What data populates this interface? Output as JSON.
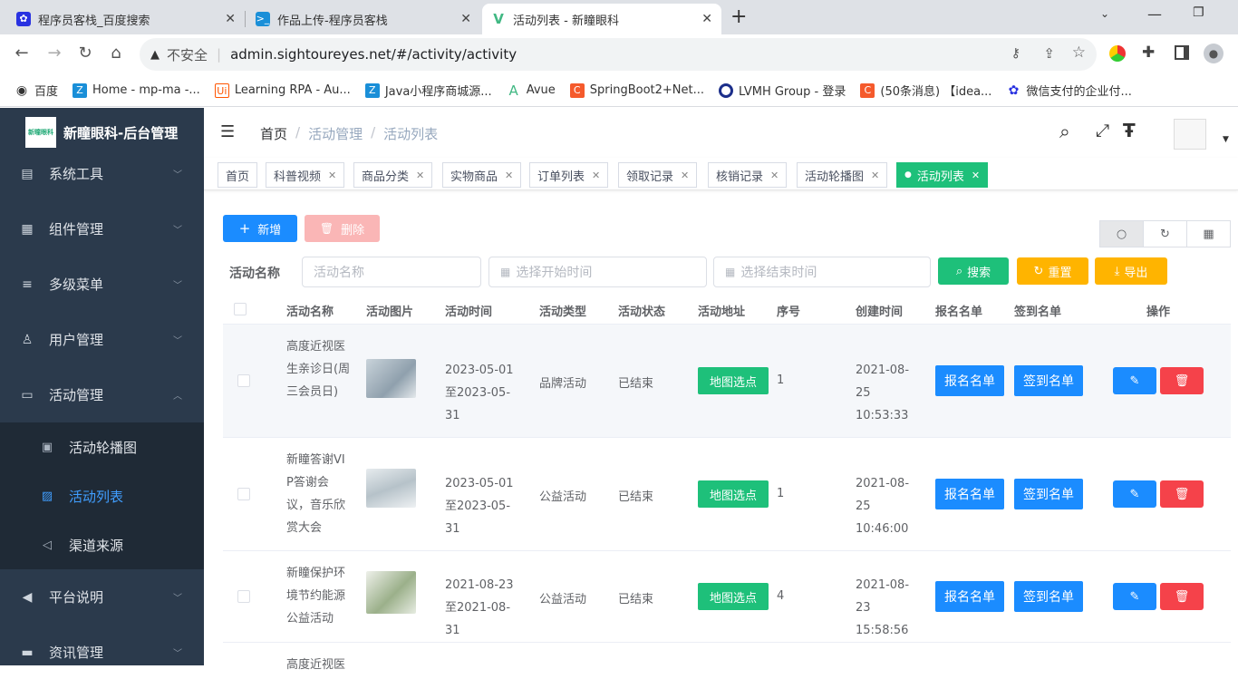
{
  "browser": {
    "tabs": [
      {
        "title": "程序员客栈_百度搜索",
        "fav": "paw-icon"
      },
      {
        "title": "作品上传-程序员客栈",
        "fav": "terminal-icon"
      },
      {
        "title": "活动列表 - 新瞳眼科",
        "fav": "vue-icon"
      }
    ],
    "new_tab": "+",
    "security": "不安全",
    "url": "admin.sightoureyes.net/#/activity/activity",
    "bookmarks": [
      {
        "label": "百度"
      },
      {
        "label": "Home - mp-ma -..."
      },
      {
        "label": "Learning RPA - Au..."
      },
      {
        "label": "Java小程序商城源..."
      },
      {
        "label": "Avue"
      },
      {
        "label": "SpringBoot2+Net..."
      },
      {
        "label": "LVMH Group - 登录"
      },
      {
        "label": "(50条消息) 【idea..."
      },
      {
        "label": "微信支付的企业付..."
      }
    ]
  },
  "sidebar": {
    "logo_text": "新瞳眼科-后台管理",
    "logo_mark": "新瞳眼科",
    "items": [
      {
        "label": "系统工具",
        "icon": "briefcase-icon"
      },
      {
        "label": "组件管理",
        "icon": "grid-icon"
      },
      {
        "label": "多级菜单",
        "icon": "list-icon"
      },
      {
        "label": "用户管理",
        "icon": "user-icon"
      },
      {
        "label": "活动管理",
        "icon": "monitor-icon"
      }
    ],
    "sub_items": [
      {
        "label": "活动轮播图",
        "icon": "image-icon"
      },
      {
        "label": "活动列表",
        "icon": "gallery-icon"
      },
      {
        "label": "渠道来源",
        "icon": "send-icon"
      }
    ],
    "items_after": [
      {
        "label": "平台说明",
        "icon": "speaker-icon"
      },
      {
        "label": "资讯管理",
        "icon": "chat-icon"
      }
    ]
  },
  "breadcrumb": {
    "home": "首页",
    "sep": "/",
    "level1": "活动管理",
    "level2": "活动列表"
  },
  "tags": [
    "首页",
    "科普视频",
    "商品分类",
    "实物商品",
    "订单列表",
    "领取记录",
    "核销记录",
    "活动轮播图",
    "活动列表"
  ],
  "toolbar": {
    "add": "新增",
    "delete": "删除"
  },
  "search": {
    "label": "活动名称",
    "name_placeholder": "活动名称",
    "start_placeholder": "选择开始时间",
    "end_placeholder": "选择结束时间",
    "search_btn": "搜索",
    "reset_btn": "重置",
    "export_btn": "导出"
  },
  "table": {
    "headers": [
      "活动名称",
      "活动图片",
      "活动时间",
      "活动类型",
      "活动状态",
      "活动地址",
      "序号",
      "创建时间",
      "报名名单",
      "签到名单",
      "操作"
    ],
    "rows": [
      {
        "name": "高度近视医生亲诊日(周三会员日)",
        "time": "2023-05-01至2023-05-31",
        "type": "品牌活动",
        "status": "已结束",
        "addr_btn": "地图选点",
        "seq": "1",
        "created": "2021-08-25 10:53:33",
        "signup": "报名名单",
        "checkin": "签到名单"
      },
      {
        "name": "新瞳答谢VIP答谢会议，音乐欣赏大会",
        "time": "2023-05-01至2023-05-31",
        "type": "公益活动",
        "status": "已结束",
        "addr_btn": "地图选点",
        "seq": "1",
        "created": "2021-08-25 10:46:00",
        "signup": "报名名单",
        "checkin": "签到名单"
      },
      {
        "name": "新瞳保护环境节约能源公益活动",
        "time": "2021-08-23至2021-08-31",
        "type": "公益活动",
        "status": "已结束",
        "addr_btn": "地图选点",
        "seq": "4",
        "created": "2021-08-23 15:58:56",
        "signup": "报名名单",
        "checkin": "签到名单"
      },
      {
        "name": "高度近视医",
        "time": "",
        "type": "",
        "status": "",
        "addr_btn": "",
        "seq": "",
        "created": "",
        "signup": "",
        "checkin": ""
      }
    ]
  },
  "colors": {
    "primary": "#1b8cff",
    "success": "#1ec07a",
    "danger": "#f5424a",
    "warning": "#ffb400",
    "sidebar": "#2b3a4c"
  }
}
